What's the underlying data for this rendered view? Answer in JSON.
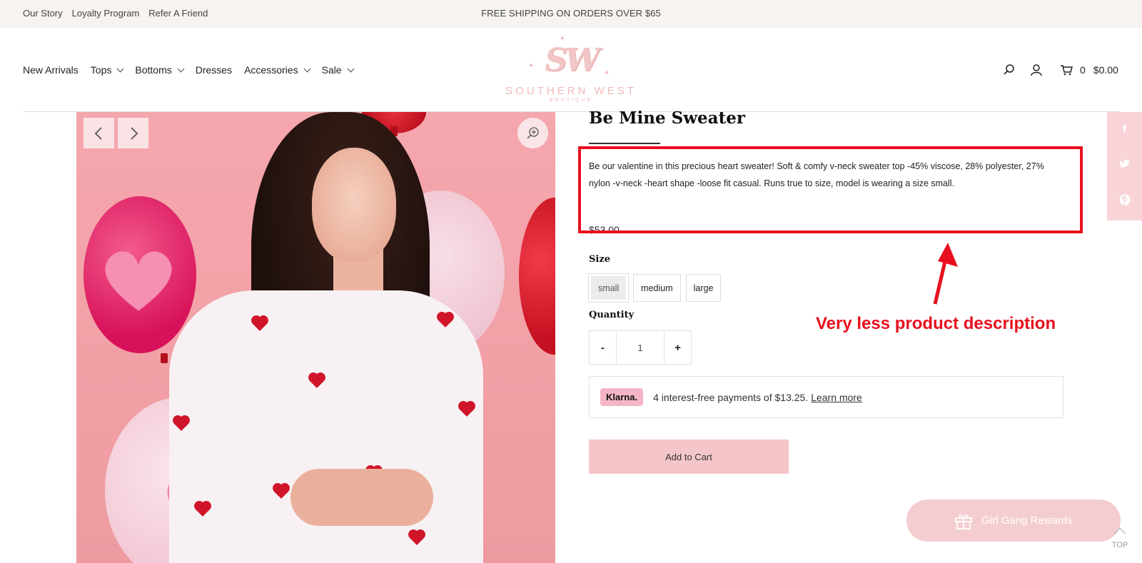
{
  "topbar": {
    "links": [
      "Our Story",
      "Loyalty Program",
      "Refer A Friend"
    ],
    "promo": "FREE SHIPPING ON ORDERS OVER $65"
  },
  "nav": {
    "items": [
      {
        "label": "New Arrivals",
        "has_dropdown": false
      },
      {
        "label": "Tops",
        "has_dropdown": true
      },
      {
        "label": "Bottoms",
        "has_dropdown": true
      },
      {
        "label": "Dresses",
        "has_dropdown": false
      },
      {
        "label": "Accessories",
        "has_dropdown": true
      },
      {
        "label": "Sale",
        "has_dropdown": true
      }
    ]
  },
  "logo": {
    "monogram": "SW",
    "name": "SOUTHERN WEST",
    "sub": "BOUTIQUE",
    "color": "#f0b9b9"
  },
  "header_icons": {
    "search_icon": "search-icon",
    "account_icon": "user-icon",
    "cart_icon": "cart-icon",
    "cart_count": "0",
    "cart_total": "$0.00"
  },
  "product": {
    "title": "Be Mine Sweater",
    "description": "Be our valentine in this precious heart sweater! Soft & comfy v-neck sweater top -45% viscose, 28% polyester, 27% nylon -v-neck -heart shape -loose fit casual. Runs true to size, model is wearing a size small.",
    "price": "$53.00",
    "size_label": "Size",
    "sizes": [
      {
        "label": "small",
        "selected": true
      },
      {
        "label": "medium",
        "selected": false
      },
      {
        "label": "large",
        "selected": false
      }
    ],
    "quantity_label": "Quantity",
    "quantity": "1",
    "qty_minus": "-",
    "qty_plus": "+",
    "add_to_cart": "Add to Cart"
  },
  "klarna": {
    "badge": "Klarna.",
    "text": "4 interest-free payments of $13.25.",
    "link": "Learn more",
    "badge_color": "#f4b6c7"
  },
  "annotation": {
    "text": "Very less product description",
    "color": "#e8101e"
  },
  "share": {
    "icons": [
      "facebook-icon",
      "twitter-icon",
      "pinterest-icon"
    ],
    "glyphs": [
      "f",
      "t",
      "p"
    ]
  },
  "rewards": {
    "label": "Girl Gang Rewards",
    "icon": "gift-icon"
  },
  "back_to_top": "TOP",
  "colors": {
    "accent_pink": "#f5c6c9",
    "topbar_bg": "#f6f3f1"
  }
}
